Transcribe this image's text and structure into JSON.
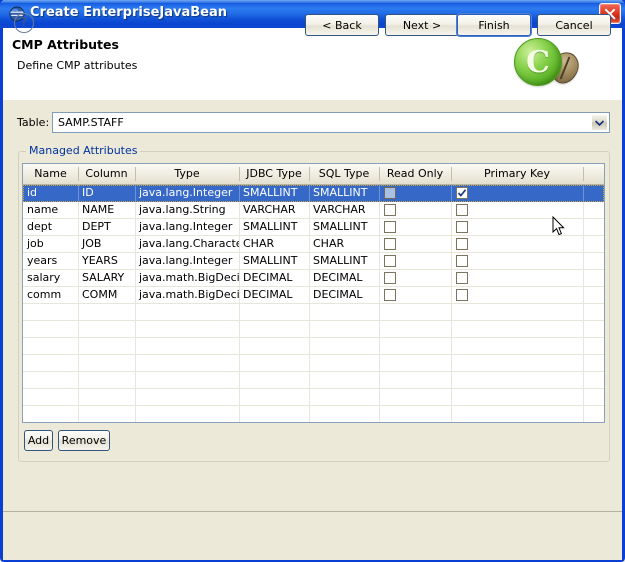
{
  "window": {
    "title": "Create EnterpriseJavaBean",
    "icon": "eclipse-sphere-icon",
    "close_label": "close-button",
    "frame_color": "#0a3fd4"
  },
  "header": {
    "title": "CMP Attributes",
    "subtitle": "Define CMP attributes",
    "logo_letter": "C",
    "logo_color": "#7ac53a"
  },
  "form": {
    "table_label": "Table:",
    "table_value": "SAMP.STAFF",
    "table_placeholder": "SAMP.STAFF"
  },
  "group": {
    "legend": "Managed Attributes",
    "legend_color": "#0032a0"
  },
  "grid": {
    "columns": [
      {
        "label": "Name"
      },
      {
        "label": "Column"
      },
      {
        "label": "Type"
      },
      {
        "label": "JDBC Type"
      },
      {
        "label": "SQL Type"
      },
      {
        "label": "Read Only"
      },
      {
        "label": "Primary Key"
      }
    ],
    "rows": [
      {
        "name": "id",
        "column": "ID",
        "type": "java.lang.Integer",
        "jdbc_type": "SMALLINT",
        "sql_type": "SMALLINT",
        "read_only": false,
        "primary_key": true,
        "selected": true,
        "read_only_focused": true
      },
      {
        "name": "name",
        "column": "NAME",
        "type": "java.lang.String",
        "jdbc_type": "VARCHAR",
        "sql_type": "VARCHAR",
        "read_only": false,
        "primary_key": false,
        "selected": false,
        "read_only_focused": false
      },
      {
        "name": "dept",
        "column": "DEPT",
        "type": "java.lang.Integer",
        "jdbc_type": "SMALLINT",
        "sql_type": "SMALLINT",
        "read_only": false,
        "primary_key": false,
        "selected": false,
        "read_only_focused": false
      },
      {
        "name": "job",
        "column": "JOB",
        "type": "java.lang.Character",
        "jdbc_type": "CHAR",
        "sql_type": "CHAR",
        "read_only": false,
        "primary_key": false,
        "selected": false,
        "read_only_focused": false
      },
      {
        "name": "years",
        "column": "YEARS",
        "type": "java.lang.Integer",
        "jdbc_type": "SMALLINT",
        "sql_type": "SMALLINT",
        "read_only": false,
        "primary_key": false,
        "selected": false,
        "read_only_focused": false
      },
      {
        "name": "salary",
        "column": "SALARY",
        "type": "java.math.BigDecimal",
        "jdbc_type": "DECIMAL",
        "sql_type": "DECIMAL",
        "read_only": false,
        "primary_key": false,
        "selected": false,
        "read_only_focused": false
      },
      {
        "name": "comm",
        "column": "COMM",
        "type": "java.math.BigDecimal",
        "jdbc_type": "DECIMAL",
        "sql_type": "DECIMAL",
        "read_only": false,
        "primary_key": false,
        "selected": false,
        "read_only_focused": false
      }
    ],
    "empty_row_count": 7,
    "selection_color": "#3668c8"
  },
  "list_actions": {
    "add_label": "Add",
    "remove_label": "Remove"
  },
  "footer": {
    "help_label": "?",
    "back_label": "< Back",
    "next_label": "Next >",
    "finish_label": "Finish",
    "cancel_label": "Cancel",
    "default_button": "Finish"
  }
}
